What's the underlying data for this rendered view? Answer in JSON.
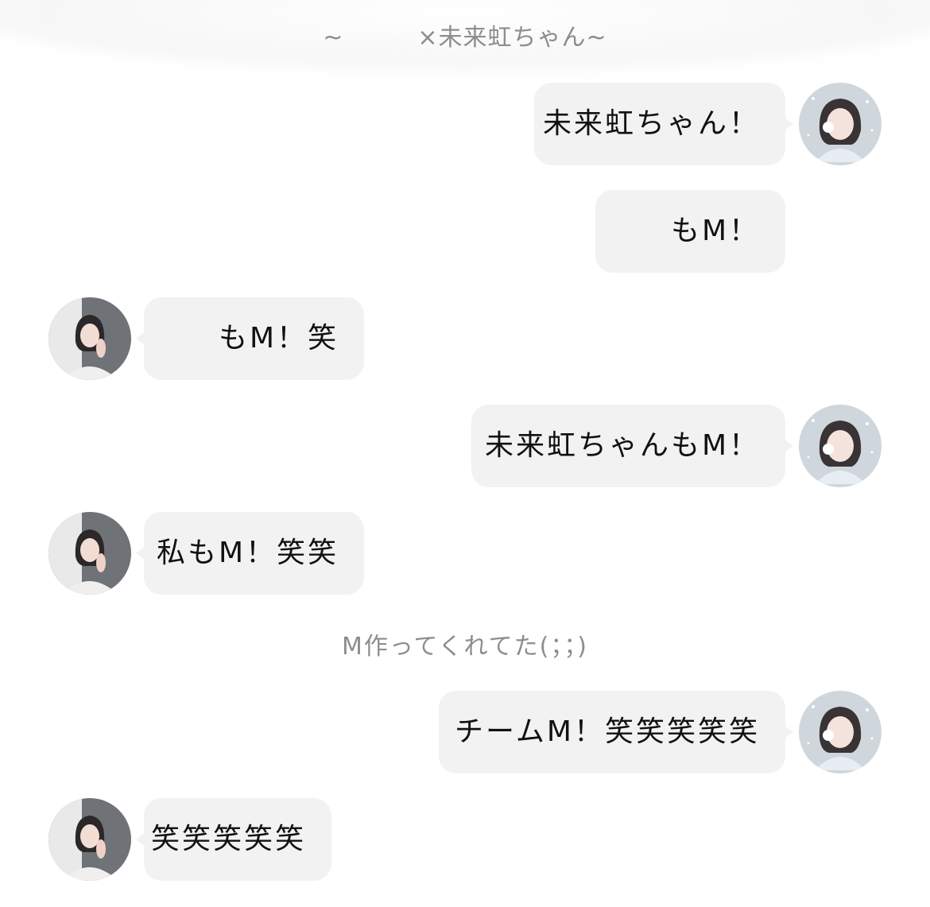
{
  "header": {
    "title": "~　　　×未来虹ちゃん~"
  },
  "system_note": "M作ってくれてた(；；)",
  "messages": [
    {
      "side": "right",
      "text": "未来虹ちゃん！",
      "avatar": "self-avatar"
    },
    {
      "side": "right",
      "text": "　　もM！",
      "avatar": "none"
    },
    {
      "side": "left",
      "text": "　　もM！笑",
      "avatar": "partner-avatar"
    },
    {
      "side": "right",
      "text": "未来虹ちゃんもM！",
      "avatar": "self-avatar"
    },
    {
      "side": "left",
      "text": "私もM！笑笑",
      "avatar": "partner-avatar"
    },
    {
      "side": "right",
      "text": "チームM！笑笑笑笑笑",
      "avatar": "self-avatar"
    },
    {
      "side": "left",
      "text": "笑笑笑笑笑",
      "avatar": "partner-avatar"
    }
  ],
  "colors": {
    "bubble": "#f2f2f2",
    "meta_text": "#8d8d8d",
    "message_text": "#111111"
  }
}
